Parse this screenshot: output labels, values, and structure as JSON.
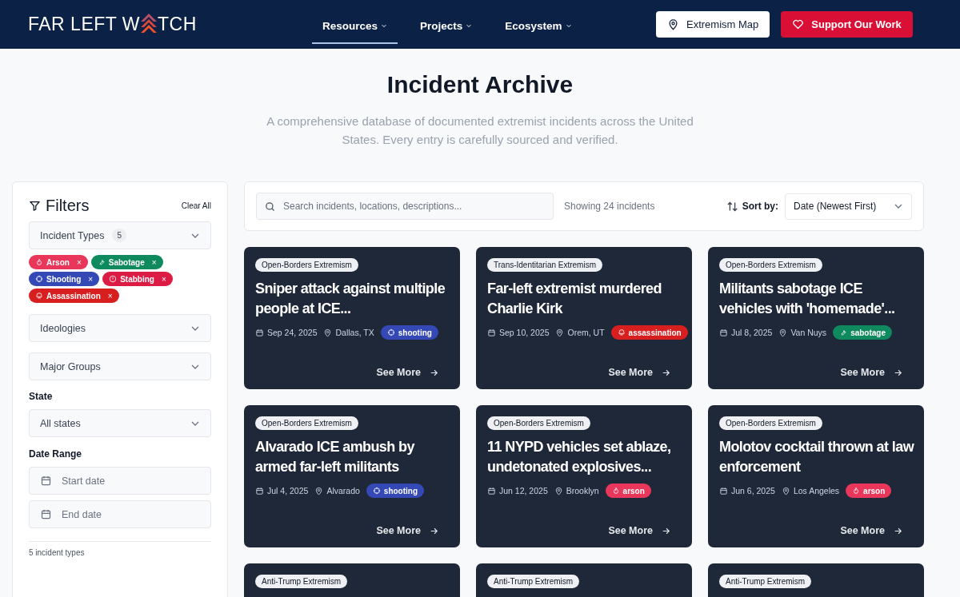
{
  "header": {
    "logo": {
      "before": "FAR LEFT W",
      "after": "TCH"
    },
    "nav": [
      {
        "label": "Resources",
        "selected": true
      },
      {
        "label": "Projects",
        "selected": false
      },
      {
        "label": "Ecosystem",
        "selected": false
      }
    ],
    "buttons": [
      {
        "label": "Extremism Map",
        "kind": "map"
      },
      {
        "label": "Support Our Work",
        "kind": "support"
      }
    ]
  },
  "hero": {
    "title": "Incident Archive",
    "subtitle": "A comprehensive database of documented extremist incidents across the United States. Every entry is carefully sourced and verified."
  },
  "filters": {
    "title": "Filters",
    "clear": "Clear All",
    "incident_types": {
      "label": "Incident Types",
      "count": "5"
    },
    "tags": [
      {
        "label": "Arson",
        "kind": "arson",
        "color": "#e8375a",
        "remove": "×"
      },
      {
        "label": "Sabotage",
        "kind": "sabotage",
        "color": "#0f8a5f",
        "remove": "×"
      },
      {
        "label": "Shooting",
        "kind": "shooting",
        "color": "#3449b5",
        "remove": "×"
      },
      {
        "label": "Stabbing",
        "kind": "stabbing",
        "color": "#dc1c45",
        "remove": "×"
      },
      {
        "label": "Assassination",
        "kind": "assassination",
        "color": "#d81f1f",
        "remove": "×"
      }
    ],
    "dropdowns": [
      "Ideologies",
      "Major Groups"
    ],
    "state_label": "State",
    "state_value": "All states",
    "date_label": "Date Range",
    "date_fields": [
      {
        "placeholder": "Start date"
      },
      {
        "placeholder": "End date"
      }
    ],
    "footer": "5 incident types"
  },
  "toolbar": {
    "search_placeholder": "Search incidents, locations, descriptions...",
    "count": "Showing 24 incidents",
    "sort_label": "Sort by:",
    "sort_value": "Date (Newest First)"
  },
  "cards": [
    {
      "ideology": "Open-Borders Extremism",
      "title": "Sniper attack against multiple people at ICE...",
      "date": "Sep 24, 2025",
      "location": "Dallas, TX",
      "type": {
        "label": "shooting",
        "kind": "shooting",
        "color": "#3449b5"
      },
      "link": "See More"
    },
    {
      "ideology": "Trans-Identitarian Extremism",
      "title": "Far-left extremist murdered Charlie Kirk",
      "date": "Sep 10, 2025",
      "location": "Orem, UT",
      "type": {
        "label": "assassination",
        "kind": "assassination",
        "color": "#d81f1f"
      },
      "link": "See More"
    },
    {
      "ideology": "Open-Borders Extremism",
      "title": "Militants sabotage ICE vehicles with 'homemade'...",
      "date": "Jul 8, 2025",
      "location": "Van Nuys",
      "type": {
        "label": "sabotage",
        "kind": "sabotage",
        "color": "#0f8a5f"
      },
      "link": "See More"
    },
    {
      "ideology": "Open-Borders Extremism",
      "title": "Alvarado ICE ambush by armed far-left militants",
      "date": "Jul 4, 2025",
      "location": "Alvarado",
      "type": {
        "label": "shooting",
        "kind": "shooting",
        "color": "#3449b5"
      },
      "link": "See More"
    },
    {
      "ideology": "Open-Borders Extremism",
      "title": "11 NYPD vehicles set ablaze, undetonated explosives...",
      "date": "Jun 12, 2025",
      "location": "Brooklyn",
      "type": {
        "label": "arson",
        "kind": "arson",
        "color": "#e8375a"
      },
      "link": "See More"
    },
    {
      "ideology": "Open-Borders Extremism",
      "title": "Molotov cocktail thrown at law enforcement",
      "date": "Jun 6, 2025",
      "location": "Los Angeles",
      "type": {
        "label": "arson",
        "kind": "arson",
        "color": "#e8375a"
      },
      "link": "See More"
    },
    {
      "ideology": "Anti-Trump Extremism"
    },
    {
      "ideology": "Anti-Trump Extremism"
    },
    {
      "ideology": "Anti-Trump Extremism"
    }
  ]
}
